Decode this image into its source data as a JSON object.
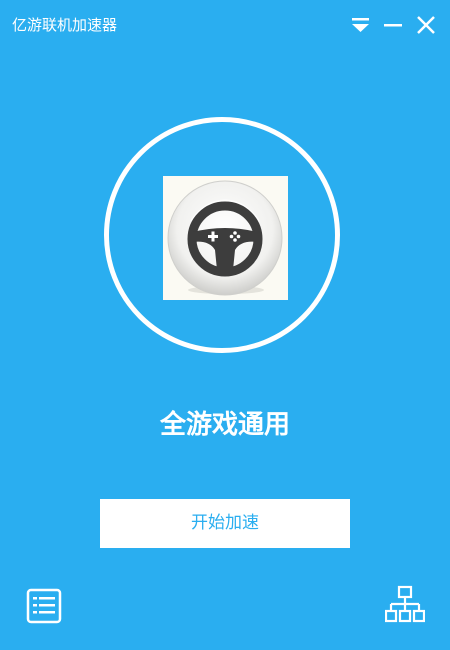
{
  "window": {
    "title": "亿游联机加速器",
    "controls": [
      "menu-dropdown-icon",
      "minimize-icon",
      "close-icon"
    ]
  },
  "main": {
    "logo_icon": "gamepad-steering-wheel-icon",
    "mode_label": "全游戏通用",
    "start_button_label": "开始加速"
  },
  "footer": {
    "left_icon": "list-icon",
    "right_icon": "network-icon"
  },
  "colors": {
    "background": "#2aaef0",
    "button_bg": "#ffffff",
    "button_text": "#2aaef0"
  }
}
